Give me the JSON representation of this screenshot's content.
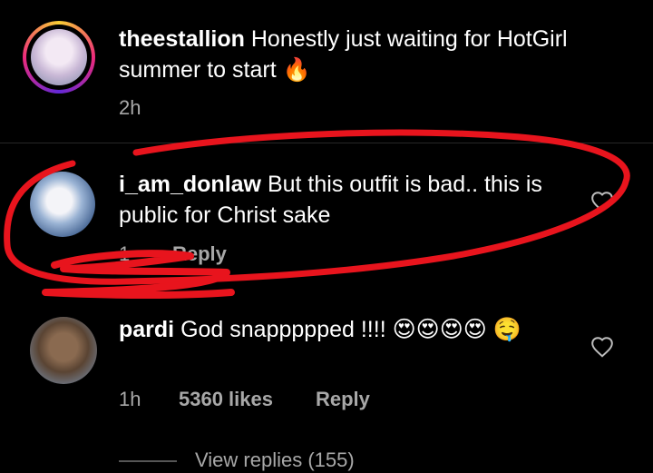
{
  "comments": [
    {
      "username": "theestallion",
      "text": "Honestly just waiting for HotGirl summer to start",
      "emoji": "🔥",
      "time": "2h"
    },
    {
      "username": "i_am_donlaw",
      "text": "But this outfit is bad.. this is public for Christ sake",
      "time": "1",
      "reply_label": "Reply"
    },
    {
      "username": "pardi",
      "text": "God snappppped !!!!",
      "emoji": "😍😍😍😍 🤤",
      "time": "1h",
      "likes": "5360 likes",
      "reply_label": "Reply"
    }
  ],
  "view_replies": "View replies (155)",
  "colors": {
    "annotation_red": "#e8141d",
    "meta_gray": "#a8a8a8",
    "background": "#000000"
  },
  "icons": {
    "like": "heart-outline-icon",
    "fire": "fire-emoji"
  }
}
